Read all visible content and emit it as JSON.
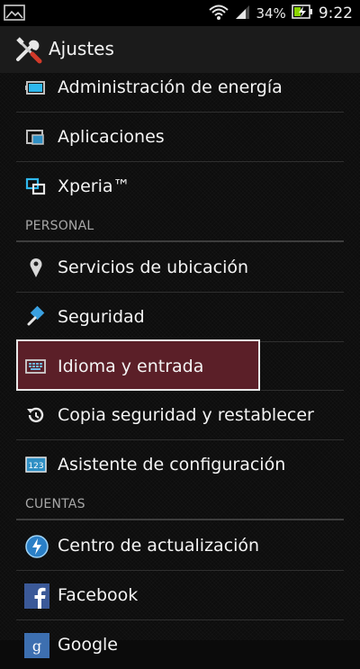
{
  "status_bar": {
    "battery_percent": "34%",
    "time": "9:22",
    "icons": [
      "image-notification-icon",
      "wifi-icon",
      "signal-icon",
      "battery-charging-icon"
    ]
  },
  "action_bar": {
    "title": "Ajustes",
    "icon": "tools-icon"
  },
  "items": [
    {
      "label": "Administración de energía",
      "icon": "battery-icon"
    },
    {
      "label": "Aplicaciones",
      "icon": "apps-icon"
    },
    {
      "label": "Xperia™",
      "icon": "xperia-icon"
    }
  ],
  "sections": {
    "personal": "PERSONAL",
    "cuentas": "CUENTAS"
  },
  "personal_items": [
    {
      "label": "Servicios de ubicación",
      "icon": "location-pin-icon"
    },
    {
      "label": "Seguridad",
      "icon": "security-icon"
    },
    {
      "label": "Idioma y entrada",
      "icon": "keyboard-icon",
      "selected": true
    },
    {
      "label": "Copia seguridad y restablecer",
      "icon": "restore-icon"
    },
    {
      "label": "Asistente de configuración",
      "icon": "setup-wizard-icon"
    }
  ],
  "account_items": [
    {
      "label": "Centro de actualización",
      "icon": "update-center-icon"
    },
    {
      "label": "Facebook",
      "icon": "facebook-icon"
    },
    {
      "label": "Google",
      "icon": "google-icon"
    }
  ],
  "colors": {
    "selected_bg": "#5b1f28",
    "selected_border": "#e8e8e8",
    "battery_green": "#8bd400"
  }
}
